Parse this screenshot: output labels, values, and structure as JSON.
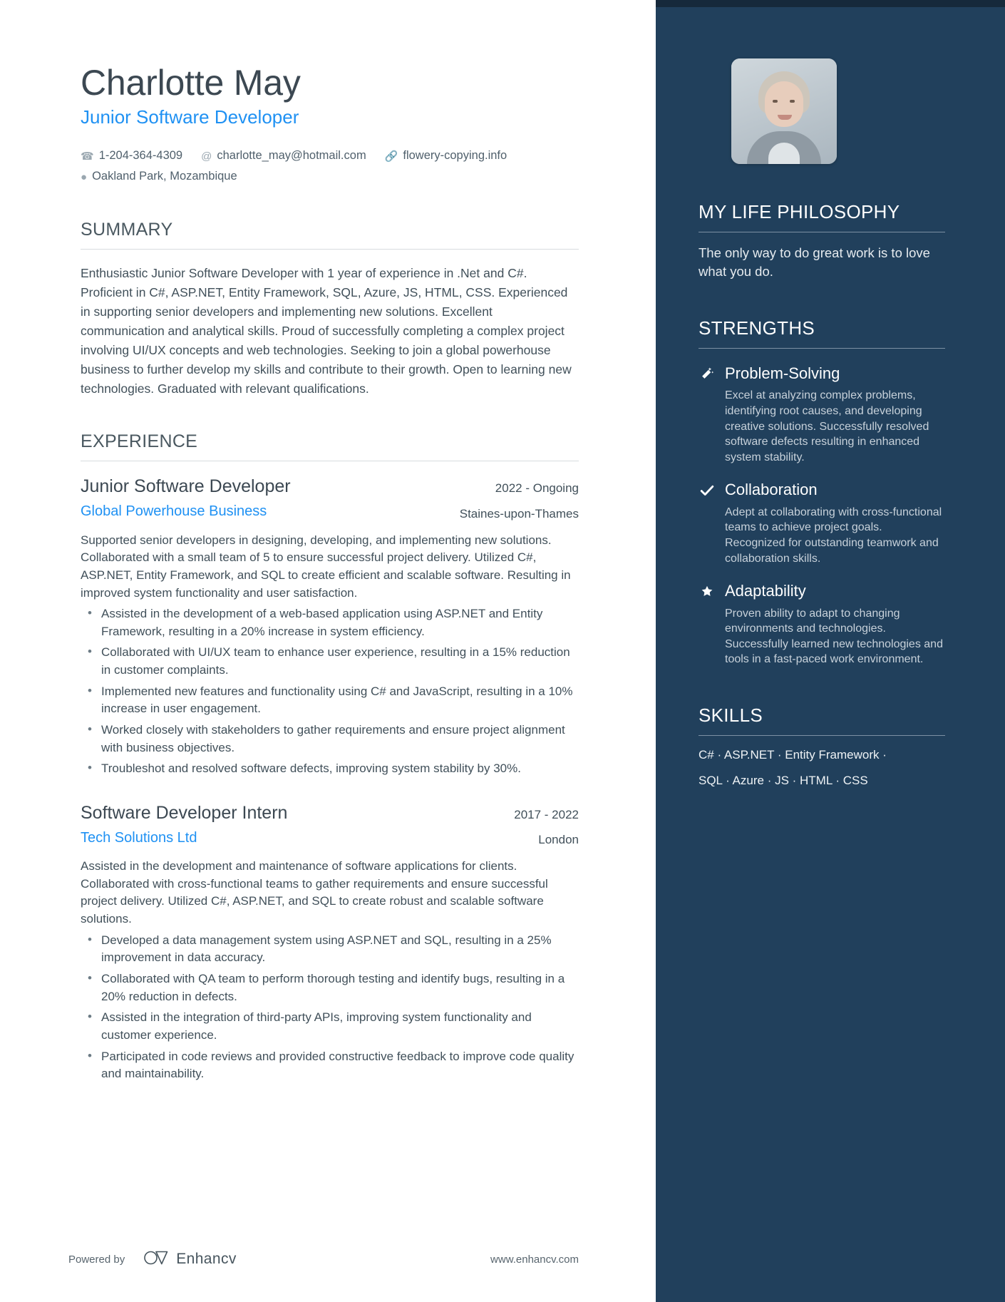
{
  "header": {
    "name": "Charlotte May",
    "role": "Junior Software Developer",
    "phone": "1-204-364-4309",
    "email": "charlotte_may@hotmail.com",
    "website": "flowery-copying.info",
    "location": "Oakland Park, Mozambique",
    "icons": {
      "phone": "phone-icon",
      "email": "at-icon",
      "website": "link-icon",
      "location": "map-pin-icon"
    }
  },
  "summary": {
    "title": "SUMMARY",
    "text": "Enthusiastic Junior Software Developer with 1 year of experience in .Net and C#. Proficient in C#, ASP.NET, Entity Framework, SQL, Azure, JS, HTML, CSS. Experienced in supporting senior developers and implementing new solutions. Excellent communication and analytical skills. Proud of successfully completing a complex project involving UI/UX concepts and web technologies. Seeking to join a global powerhouse business to further develop my skills and contribute to their growth. Open to learning new technologies. Graduated with relevant qualifications."
  },
  "experience": {
    "title": "EXPERIENCE",
    "jobs": [
      {
        "title": "Junior Software Developer",
        "company": "Global Powerhouse Business",
        "dates": "2022 - Ongoing",
        "location": "Staines-upon-Thames",
        "description": "Supported senior developers in designing, developing, and implementing new solutions. Collaborated with a small team of 5 to ensure successful project delivery. Utilized C#, ASP.NET, Entity Framework, and SQL to create efficient and scalable software. Resulting in improved system functionality and user satisfaction.",
        "bullets": [
          "Assisted in the development of a web-based application using ASP.NET and Entity Framework, resulting in a 20% increase in system efficiency.",
          "Collaborated with UI/UX team to enhance user experience, resulting in a 15% reduction in customer complaints.",
          "Implemented new features and functionality using C# and JavaScript, resulting in a 10% increase in user engagement.",
          "Worked closely with stakeholders to gather requirements and ensure project alignment with business objectives.",
          "Troubleshot and resolved software defects, improving system stability by 30%."
        ]
      },
      {
        "title": "Software Developer Intern",
        "company": "Tech Solutions Ltd",
        "dates": "2017 - 2022",
        "location": "London",
        "description": "Assisted in the development and maintenance of software applications for clients. Collaborated with cross-functional teams to gather requirements and ensure successful project delivery. Utilized C#, ASP.NET, and SQL to create robust and scalable software solutions.",
        "bullets": [
          "Developed a data management system using ASP.NET and SQL, resulting in a 25% improvement in data accuracy.",
          "Collaborated with QA team to perform thorough testing and identify bugs, resulting in a 20% reduction in defects.",
          "Assisted in the integration of third-party APIs, improving system functionality and customer experience.",
          "Participated in code reviews and provided constructive feedback to improve code quality and maintainability."
        ]
      }
    ]
  },
  "sidebar": {
    "philosophy": {
      "title": "MY LIFE PHILOSOPHY",
      "quote": "The only way to do great work is to love what you do."
    },
    "strengths": {
      "title": "STRENGTHS",
      "items": [
        {
          "icon": "magic-wand-icon",
          "name": "Problem-Solving",
          "description": "Excel at analyzing complex problems, identifying root causes, and developing creative solutions. Successfully resolved software defects resulting in enhanced system stability."
        },
        {
          "icon": "check-icon",
          "name": "Collaboration",
          "description": "Adept at collaborating with cross-functional teams to achieve project goals. Recognized for outstanding teamwork and collaboration skills."
        },
        {
          "icon": "star-icon",
          "name": "Adaptability",
          "description": "Proven ability to adapt to changing environments and technologies. Successfully learned new technologies and tools in a fast-paced work environment."
        }
      ]
    },
    "skills": {
      "title": "SKILLS",
      "lines": [
        "C# · ASP.NET · Entity Framework ·",
        "SQL · Azure ·  JS · HTML · CSS"
      ]
    }
  },
  "footer": {
    "powered_by": "Powered by",
    "brand": "Enhancv",
    "url": "www.enhancv.com"
  },
  "colors": {
    "sidebar_bg": "#21405c",
    "sidebar_top_bar": "#16293b",
    "accent_blue": "#1f91f3",
    "body_text": "#41505a"
  }
}
